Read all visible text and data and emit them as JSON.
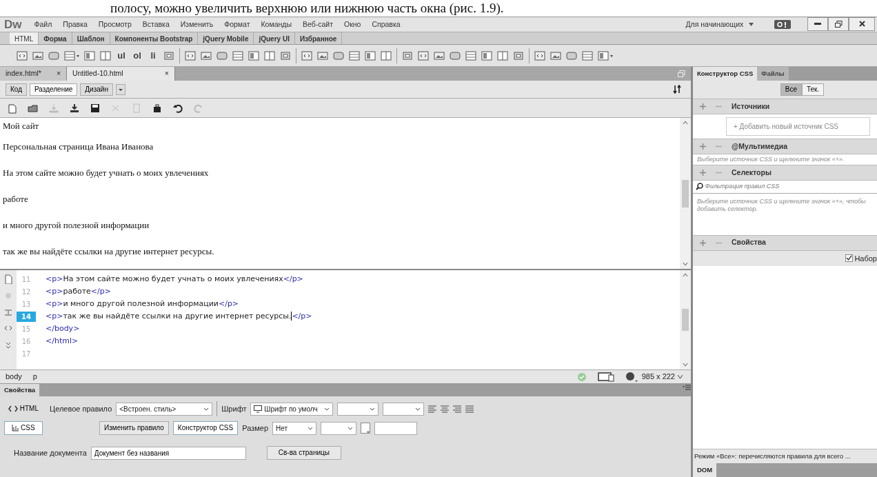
{
  "page_text": "полосу, можно увеличить верхнюю или нижнюю часть окна (рис. 1.9).",
  "app": {
    "logo": "Dw",
    "menu": [
      "Файл",
      "Правка",
      "Просмотр",
      "Вставка",
      "Изменить",
      "Формат",
      "Команды",
      "Веб-сайт",
      "Окно",
      "Справка"
    ],
    "workspace": "Для начинающих"
  },
  "insert_tabs": [
    {
      "label": "HTML",
      "selected": true
    },
    {
      "label": "Форма",
      "selected": false
    },
    {
      "label": "Шаблон",
      "selected": false
    },
    {
      "label": "Компоненты Bootstrap",
      "selected": false
    },
    {
      "label": "jQuery Mobile",
      "selected": false
    },
    {
      "label": "jQuery UI",
      "selected": false
    },
    {
      "label": "Избранное",
      "selected": false
    }
  ],
  "insert_toolbar": [
    {
      "kind": "icon"
    },
    {
      "kind": "icon"
    },
    {
      "kind": "icon"
    },
    {
      "kind": "icon_dropdown"
    },
    {
      "kind": "icon"
    },
    {
      "kind": "icon"
    },
    {
      "kind": "text",
      "label": "ul"
    },
    {
      "kind": "text",
      "label": "ol"
    },
    {
      "kind": "text",
      "label": "li"
    },
    {
      "kind": "icon"
    },
    {
      "kind": "separator"
    },
    {
      "kind": "icon"
    },
    {
      "kind": "icon"
    },
    {
      "kind": "icon"
    },
    {
      "kind": "icon"
    },
    {
      "kind": "icon"
    },
    {
      "kind": "icon"
    },
    {
      "kind": "icon"
    },
    {
      "kind": "separator"
    },
    {
      "kind": "icon"
    },
    {
      "kind": "icon"
    },
    {
      "kind": "icon"
    },
    {
      "kind": "icon"
    },
    {
      "kind": "icon"
    },
    {
      "kind": "icon"
    },
    {
      "kind": "separator"
    },
    {
      "kind": "icon"
    },
    {
      "kind": "icon"
    },
    {
      "kind": "icon"
    },
    {
      "kind": "icon"
    },
    {
      "kind": "icon"
    },
    {
      "kind": "icon"
    },
    {
      "kind": "icon"
    },
    {
      "kind": "icon"
    },
    {
      "kind": "separator"
    },
    {
      "kind": "icon"
    },
    {
      "kind": "icon"
    },
    {
      "kind": "icon"
    },
    {
      "kind": "icon"
    },
    {
      "kind": "icon_dropdown"
    }
  ],
  "doc_tabs": [
    {
      "label": "index.html*",
      "close": "×",
      "selected": false
    },
    {
      "label": "Untitled-10.html",
      "close": "×",
      "selected": true
    }
  ],
  "view_buttons": [
    {
      "label": "Код",
      "selected": false
    },
    {
      "label": "Разделение",
      "selected": true
    },
    {
      "label": "Дизайн",
      "selected": false
    }
  ],
  "design_view": [
    "Мой сайт",
    "Персональная страница Ивана Иванова",
    "На этом сайте можно будет учнать о моих увлечениях",
    "работе",
    "и много другой полезной информации",
    "так же вы найдёте ссылки на другие интернет ресурсы."
  ],
  "code_view": [
    {
      "number": "11",
      "code": "<p>На этом сайте можно будет учнать о моих увлечениях</p>",
      "selected": false
    },
    {
      "number": "12",
      "code": "<p>работе</p>",
      "selected": false
    },
    {
      "number": "13",
      "code": "<p>и много другой полезной информации</p>",
      "selected": false
    },
    {
      "number": "14",
      "code": "<p>так же вы найдёте ссылки на другие интернет ресурсы.</p>",
      "selected": true
    },
    {
      "number": "15",
      "code": "</body>",
      "selected": false
    },
    {
      "number": "16",
      "code": "</html>",
      "selected": false
    },
    {
      "number": "17",
      "selected": false
    }
  ],
  "status_bar": {
    "tags": [
      "body",
      "p"
    ],
    "size": "985 x 222"
  },
  "properties": {
    "title": "Свойства",
    "html_button": "HTML",
    "css_button": "CSS",
    "target_rule_label": "Целевое правило",
    "target_rule": "<Встроен. стиль>",
    "font_label": "Шрифт",
    "font": "Шрифт по умолч",
    "edit_rule": "Изменить правило",
    "css_designer": "Конструктор CSS",
    "size_label": "Размер",
    "size": "Нет",
    "doc_title_label": "Название документа",
    "doc_title": "Документ без названия",
    "page_props": "Св-ва страницы"
  },
  "css_panel": {
    "tabs": [
      {
        "label": "Конструктор CSS",
        "selected": true
      },
      {
        "label": "Файлы",
        "selected": false
      }
    ],
    "filter_buttons": [
      {
        "label": "Все",
        "selected": true
      },
      {
        "label": "Тек.",
        "selected": false
      }
    ],
    "sources_title": "Источники",
    "add_source": "+ Добавить новый источник CSS",
    "media_title": "@Мультимедиа",
    "media_hint": "Выберите источник CSS и щелкните значок «+».",
    "selectors_title": "Селекторы",
    "filter_placeholder": "Фильтрация правил CSS",
    "selectors_hint": "Выберите источник CSS и щелкните значок «+», чтобы добавить селектор.",
    "properties_title": "Свойства",
    "set_label": "Набор",
    "set_checked": true,
    "footer": "Режим «Все»: перечисляются правила для всего ...",
    "dom_tab": "DOM"
  }
}
